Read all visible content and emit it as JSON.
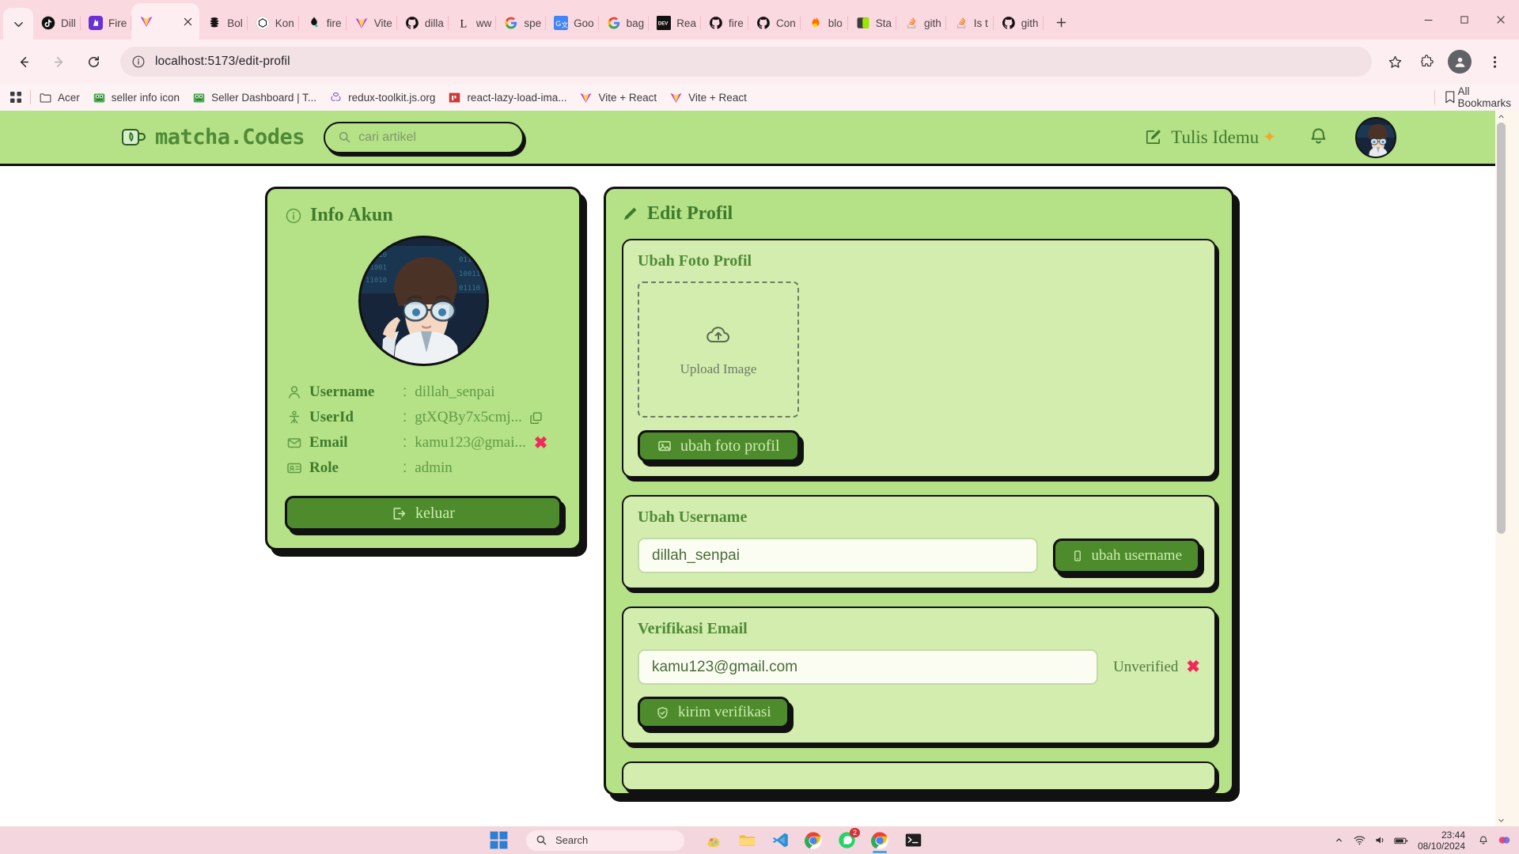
{
  "browser": {
    "tabs": [
      {
        "title": "Dill",
        "icon": "tiktok-icon",
        "active": false
      },
      {
        "title": "Fire",
        "icon": "firebase-icon",
        "active": false
      },
      {
        "title": "",
        "icon": "vite-icon",
        "active": true
      },
      {
        "title": "Bol",
        "icon": "bolt-icon",
        "active": false
      },
      {
        "title": "Kon",
        "icon": "openai-icon",
        "active": false
      },
      {
        "title": "fire",
        "icon": "firebase-console-icon",
        "active": false
      },
      {
        "title": "Vite",
        "icon": "vite-icon",
        "active": false
      },
      {
        "title": "dilla",
        "icon": "github-icon",
        "active": false
      },
      {
        "title": "ww",
        "icon": "letter-l-icon",
        "active": false
      },
      {
        "title": "spe",
        "icon": "google-icon",
        "active": false
      },
      {
        "title": "Goo",
        "icon": "google-translate-icon",
        "active": false
      },
      {
        "title": "bag",
        "icon": "google-icon",
        "active": false
      },
      {
        "title": "Rea",
        "icon": "devto-icon",
        "active": false
      },
      {
        "title": "fire",
        "icon": "github-icon",
        "active": false
      },
      {
        "title": "Con",
        "icon": "github-icon",
        "active": false
      },
      {
        "title": "blo",
        "icon": "flame-icon",
        "active": false
      },
      {
        "title": "Sta",
        "icon": "green-square-icon",
        "active": false
      },
      {
        "title": "gith",
        "icon": "stackoverflow-icon",
        "active": false
      },
      {
        "title": "Is t",
        "icon": "stackoverflow-icon",
        "active": false
      },
      {
        "title": "gith",
        "icon": "github-icon",
        "active": false
      }
    ],
    "url": "localhost:5173/edit-profil",
    "bookmarks": [
      {
        "label": "Acer",
        "icon": "folder-icon"
      },
      {
        "label": "seller info icon",
        "icon": "frog-icon"
      },
      {
        "label": "Seller Dashboard | T...",
        "icon": "frog-icon"
      },
      {
        "label": "redux-toolkit.js.org",
        "icon": "redux-icon"
      },
      {
        "label": "react-lazy-load-ima...",
        "icon": "npm-icon"
      },
      {
        "label": "Vite + React",
        "icon": "vite-icon"
      },
      {
        "label": "Vite + React",
        "icon": "vite-icon"
      }
    ],
    "all_bookmarks_label": "All Bookmarks"
  },
  "site": {
    "logo_text": "matcha.Codes",
    "search_placeholder": "cari artikel",
    "write_label": "Tulis Idemu",
    "write_sparkle": "✦"
  },
  "info_card": {
    "title": "Info Akun",
    "rows": [
      {
        "icon": "user-icon",
        "key": "Username",
        "colon": ":",
        "value": "dillah_senpai",
        "copy": false,
        "flag": ""
      },
      {
        "icon": "user-id-icon",
        "key": "UserId",
        "colon": ":",
        "value": "gtXQBy7x5cmj...",
        "copy": true,
        "flag": ""
      },
      {
        "icon": "envelope-icon",
        "key": "Email",
        "colon": ":",
        "value": "kamu123@gmai...",
        "copy": false,
        "flag": "✖"
      },
      {
        "icon": "badge-icon",
        "key": "Role",
        "colon": ":",
        "value": "admin",
        "copy": false,
        "flag": ""
      }
    ],
    "logout_label": "keluar"
  },
  "edit_panel": {
    "title": "Edit Profil",
    "photo_section": {
      "heading": "Ubah Foto Profil",
      "dropzone_label": "Upload Image",
      "button_label": "ubah foto profil"
    },
    "username_section": {
      "heading": "Ubah Username",
      "input_value": "dillah_senpai",
      "button_label": "ubah username"
    },
    "email_section": {
      "heading": "Verifikasi Email",
      "input_value": "kamu123@gmail.com",
      "status_label": "Unverified",
      "status_mark": "✖",
      "button_label": "kirim verifikasi"
    }
  },
  "taskbar": {
    "search_label": "Search",
    "whatsapp_badge": "2",
    "time": "23:44",
    "date": "08/10/2024"
  },
  "colors": {
    "brand_green": "#b5e187",
    "dark_green": "#4e8b2c",
    "text_green": "#3f7a2c",
    "section_green": "#d3edaf",
    "chrome_pink": "#fbd9e0",
    "danger": "#ef2b5b"
  }
}
